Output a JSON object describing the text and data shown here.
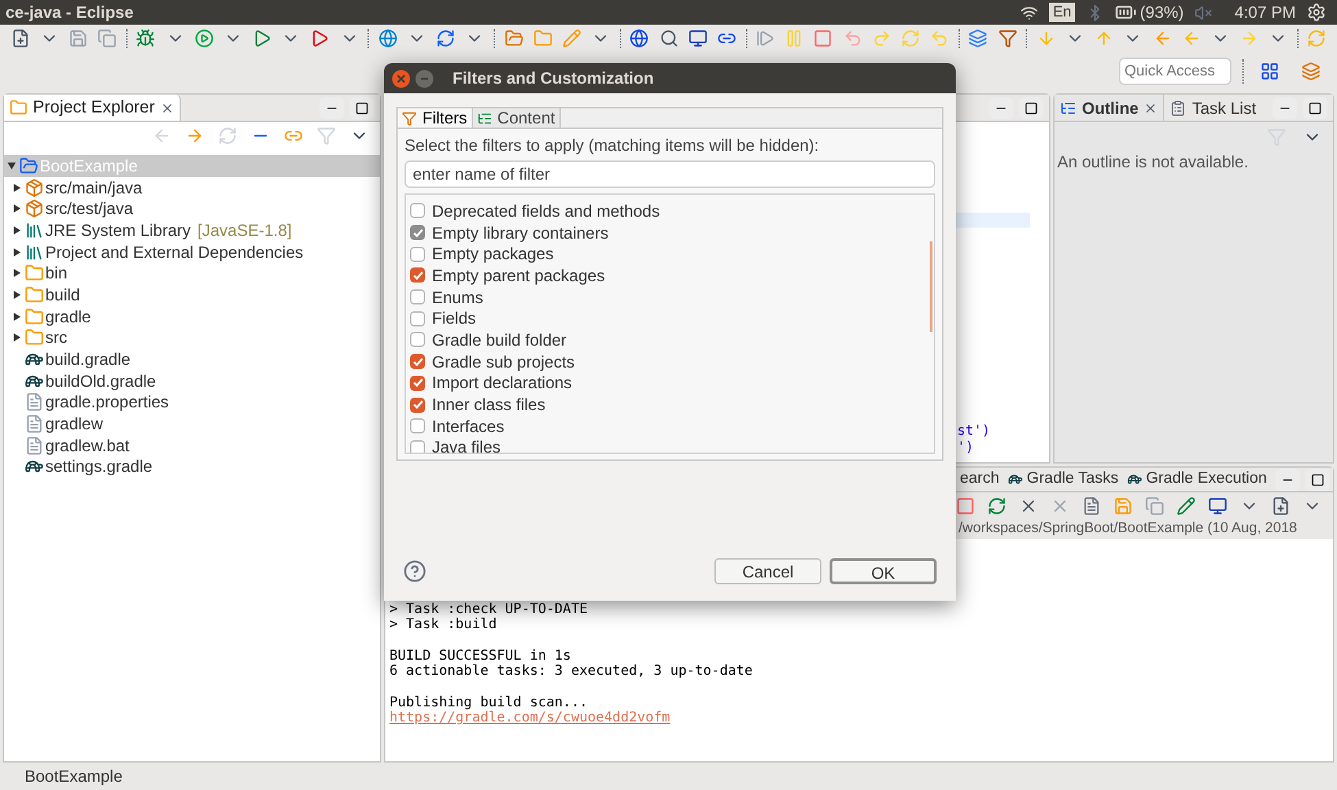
{
  "system_bar": {
    "title": "ce-java - Eclipse",
    "keyboard": "En",
    "battery": "(93%)",
    "clock": "4:07 PM"
  },
  "quick_access": {
    "placeholder": "Quick Access"
  },
  "project_explorer": {
    "title": "Project Explorer",
    "tree": [
      {
        "label": "BootExample",
        "kind": "project",
        "selected": true,
        "expanded": true,
        "children": [
          {
            "label": "src/main/java",
            "kind": "source",
            "selected": false,
            "expanded": false
          },
          {
            "label": "src/test/java",
            "kind": "source",
            "selected": false,
            "expanded": false
          },
          {
            "label": "JRE System Library",
            "decoration": "[JavaSE-1.8]",
            "kind": "library",
            "selected": false,
            "expanded": false
          },
          {
            "label": "Project and External Dependencies",
            "kind": "library",
            "selected": false,
            "expanded": false
          },
          {
            "label": "bin",
            "kind": "folder",
            "selected": false,
            "expanded": false
          },
          {
            "label": "build",
            "kind": "folder",
            "selected": false,
            "expanded": false
          },
          {
            "label": "gradle",
            "kind": "folder",
            "selected": false,
            "expanded": false
          },
          {
            "label": "src",
            "kind": "folder",
            "selected": false,
            "expanded": false
          },
          {
            "label": "build.gradle",
            "kind": "gradle",
            "selected": false
          },
          {
            "label": "buildOld.gradle",
            "kind": "gradle",
            "selected": false
          },
          {
            "label": "gradle.properties",
            "kind": "file",
            "selected": false
          },
          {
            "label": "gradlew",
            "kind": "file",
            "selected": false
          },
          {
            "label": "gradlew.bat",
            "kind": "file",
            "selected": false
          },
          {
            "label": "settings.gradle",
            "kind": "gradle",
            "selected": false
          }
        ]
      }
    ]
  },
  "editor": {
    "code_lines": [
      "st')",
      "')"
    ]
  },
  "outline": {
    "tabs": [
      {
        "label": "Outline",
        "kind": "outline",
        "selected": true
      },
      {
        "label": "Task List",
        "kind": "tasks",
        "selected": false
      }
    ],
    "message": "An outline is not available."
  },
  "console": {
    "tabs": [
      {
        "label": "earch",
        "kind": "search"
      },
      {
        "label": "Gradle Tasks",
        "kind": "gradle"
      },
      {
        "label": "Gradle Execution",
        "kind": "gradle"
      }
    ],
    "path": "/workspaces/SpringBoot/BootExample (10 Aug, 2018",
    "blocks": [
      [
        "> Task :check UP-TO-DATE",
        "> Task :build"
      ],
      [
        "BUILD SUCCESSFUL in 1s",
        "6 actionable tasks: 3 executed, 3 up-to-date"
      ],
      [
        "Publishing build scan..."
      ]
    ],
    "link": "https://gradle.com/s/cwuoe4dd2vofm"
  },
  "dialog": {
    "title": "Filters and Customization",
    "tabs": [
      {
        "label": "Filters",
        "kind": "filters",
        "selected": true
      },
      {
        "label": "Content",
        "kind": "content",
        "selected": false
      }
    ],
    "instruction": "Select the filters to apply (matching items will be hidden):",
    "search": {
      "placeholder": "enter name of filter"
    },
    "filters": [
      {
        "label": "Deprecated fields and methods",
        "checked": false,
        "disabled": false
      },
      {
        "label": "Empty library containers",
        "checked": true,
        "disabled": true
      },
      {
        "label": "Empty packages",
        "checked": false,
        "disabled": false
      },
      {
        "label": "Empty parent packages",
        "checked": true,
        "disabled": false
      },
      {
        "label": "Enums",
        "checked": false,
        "disabled": false
      },
      {
        "label": "Fields",
        "checked": false,
        "disabled": false
      },
      {
        "label": "Gradle build folder",
        "checked": false,
        "disabled": false
      },
      {
        "label": "Gradle sub projects",
        "checked": true,
        "disabled": false
      },
      {
        "label": "Import declarations",
        "checked": true,
        "disabled": false
      },
      {
        "label": "Inner class files",
        "checked": true,
        "disabled": false
      },
      {
        "label": "Interfaces",
        "checked": false,
        "disabled": false
      },
      {
        "label": "Java files",
        "checked": false,
        "disabled": false
      }
    ],
    "buttons": [
      {
        "label": "Cancel",
        "kind": "secondary"
      },
      {
        "label": "OK",
        "kind": "default"
      }
    ]
  },
  "status_bar": {
    "text": "BootExample"
  }
}
